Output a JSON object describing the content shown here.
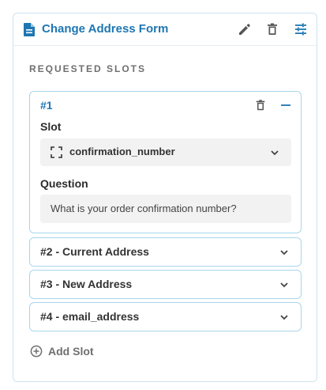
{
  "form": {
    "title": "Change Address Form",
    "icon": "document-icon",
    "accent_color": "#1e76b2",
    "actions": [
      "edit-icon",
      "trash-icon",
      "tune-icon"
    ]
  },
  "requested_slots": {
    "section_label": "REQUESTED SLOTS",
    "expanded_slot": {
      "number": "#1",
      "slot_label": "Slot",
      "slot_value": "confirmation_number",
      "question_label": "Question",
      "question_value": "What is your order confirmation number?"
    },
    "collapsed_slots": [
      {
        "title": "#2 - Current Address"
      },
      {
        "title": "#3 - New Address"
      },
      {
        "title": "#4 - email_address"
      }
    ],
    "add_slot_label": "Add Slot"
  }
}
